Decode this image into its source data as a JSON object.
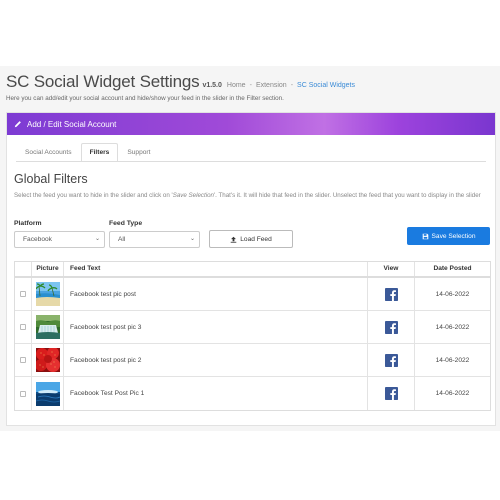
{
  "header": {
    "title": "SC Social Widget Settings",
    "version": "v1.5.0",
    "breadcrumbs": [
      "Home",
      "Extension",
      "SC Social Widgets"
    ],
    "subtitle": "Here you can add/edit your social account and hide/show your feed in the slider in the Filter section."
  },
  "panel": {
    "title": "Add / Edit Social Account",
    "tabs": [
      "Social Accounts",
      "Filters",
      "Support"
    ],
    "active_tab": "Filters"
  },
  "filters": {
    "title": "Global Filters",
    "description_prefix": "Select the feed you want to hide in the slider and click on '",
    "description_em": "Save Selection",
    "description_suffix": "'. That's it. It will hide that feed in the slider. Unselect the feed that you want to display in the slider",
    "platform_label": "Platform",
    "platform_value": "Facebook",
    "feed_type_label": "Feed Type",
    "feed_type_value": "All",
    "load_button": "Load Feed",
    "save_button": "Save Selection"
  },
  "table": {
    "headers": {
      "picture": "Picture",
      "text": "Feed Text",
      "view": "View",
      "date": "Date Posted"
    },
    "rows": [
      {
        "text": "Facebook test pic post",
        "date": "14-06-2022",
        "picture": "beach-photo",
        "view_icon": "facebook-icon"
      },
      {
        "text": "Facebook test post pic 3",
        "date": "14-06-2022",
        "picture": "waterfall-photo",
        "view_icon": "facebook-icon"
      },
      {
        "text": "Facebook test post pic 2",
        "date": "14-06-2022",
        "picture": "strawberries-photo",
        "view_icon": "facebook-icon"
      },
      {
        "text": "Facebook Test Post Pic 1",
        "date": "14-06-2022",
        "picture": "ocean-photo",
        "view_icon": "facebook-icon"
      }
    ]
  },
  "colors": {
    "header_gradient_start": "#7d3bd3",
    "header_gradient_mid": "#c070e4",
    "save_button": "#1a7be0",
    "breadcrumb_active": "#3b8bd6",
    "facebook": "#3b5998"
  }
}
